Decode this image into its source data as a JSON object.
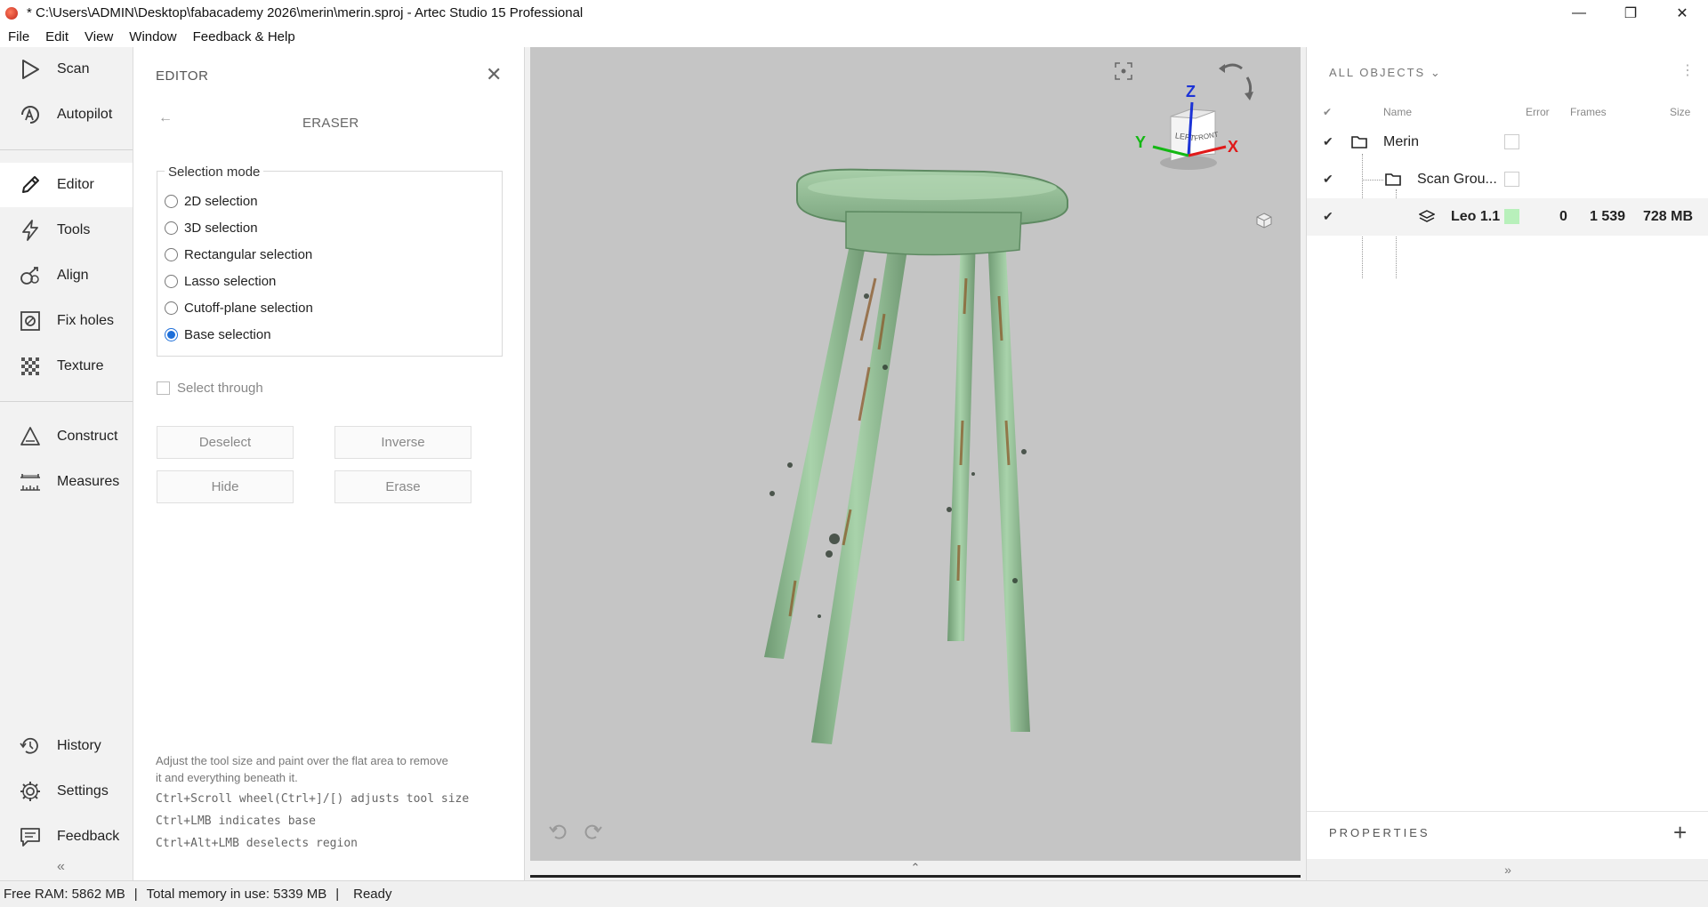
{
  "window": {
    "title": "* C:\\Users\\ADMIN\\Desktop\\fabacademy 2026\\merin\\merin.sproj - Artec Studio 15 Professional",
    "minimize_glyph": "—",
    "maximize_glyph": "❐",
    "close_glyph": "✕"
  },
  "menu": [
    "File",
    "Edit",
    "View",
    "Window",
    "Feedback & Help"
  ],
  "nav": {
    "items": [
      {
        "label": "Scan",
        "icon": "play-triangle-icon"
      },
      {
        "label": "Autopilot",
        "icon": "autopilot-icon"
      },
      {
        "label": "Editor",
        "icon": "pencil-icon"
      },
      {
        "label": "Tools",
        "icon": "lightning-icon"
      },
      {
        "label": "Align",
        "icon": "align-icon"
      },
      {
        "label": "Fix holes",
        "icon": "fix-holes-icon"
      },
      {
        "label": "Texture",
        "icon": "texture-icon"
      },
      {
        "label": "Construct",
        "icon": "construct-icon"
      },
      {
        "label": "Measures",
        "icon": "ruler-icon"
      },
      {
        "label": "History",
        "icon": "history-icon"
      },
      {
        "label": "Settings",
        "icon": "gear-icon"
      },
      {
        "label": "Feedback",
        "icon": "feedback-icon"
      }
    ],
    "active": "Editor",
    "collapse_glyph": "«"
  },
  "editor": {
    "header": "EDITOR",
    "subheader": "ERASER",
    "selection_mode_label": "Selection mode",
    "modes": [
      "2D selection",
      "3D selection",
      "Rectangular selection",
      "Lasso selection",
      "Cutoff-plane selection",
      "Base selection"
    ],
    "selected_mode": "Base selection",
    "select_through_label": "Select through",
    "select_through_checked": false,
    "buttons": {
      "deselect": "Deselect",
      "inverse": "Inverse",
      "hide": "Hide",
      "erase": "Erase"
    },
    "help": {
      "line1": "Adjust the tool size and paint over the flat area to remove",
      "line2": "it and everything beneath it.",
      "line3": "Ctrl+Scroll wheel(Ctrl+]/[) adjusts tool size",
      "line4": "Ctrl+LMB indicates base",
      "line5": "Ctrl+Alt+LMB deselects region"
    }
  },
  "viewport": {
    "axis_labels": {
      "z": "Z",
      "y": "Y",
      "x": "X"
    },
    "cube_faces": {
      "left": "LEFT",
      "front": "FRONT"
    },
    "bottom_glyph": "⌃"
  },
  "objects": {
    "title": "ALL OBJECTS",
    "columns": {
      "name": "Name",
      "error": "Error",
      "frames": "Frames",
      "size": "Size"
    },
    "rows": [
      {
        "name": "Merin",
        "error": "",
        "frames": "",
        "size": ""
      },
      {
        "name": "Scan Grou...",
        "error": "",
        "frames": "",
        "size": ""
      },
      {
        "name": "Leo 1.1",
        "error": "0",
        "frames": "1 539",
        "size": "728 MB"
      }
    ],
    "properties_label": "PROPERTIES",
    "expand_glyph": "»"
  },
  "status": {
    "free_ram": "Free RAM: 5862 MB",
    "total_memory": "Total memory in use: 5339 MB",
    "state": "Ready"
  },
  "colors": {
    "accent": "#1e6fd9",
    "scan_green": "#8fbf93",
    "viewport_bg": "#c5c5c5"
  }
}
